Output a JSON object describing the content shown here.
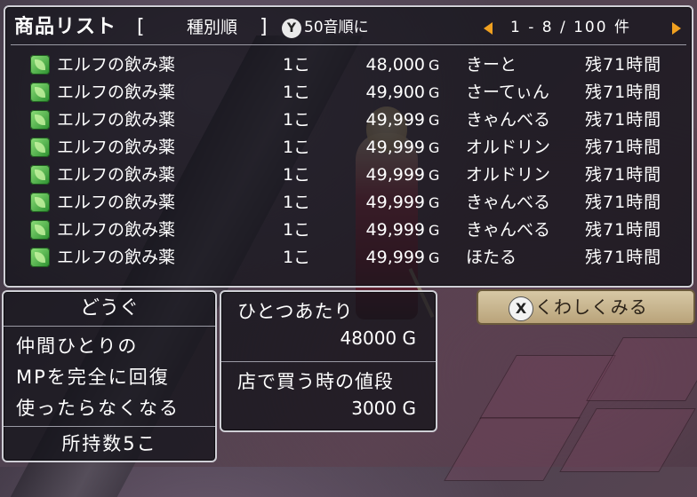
{
  "header": {
    "title": "商品リスト",
    "bracket_open": "[",
    "sort_label": "種別順",
    "bracket_close": "]",
    "y_button": "Y",
    "sort_alt_label": "50音順に",
    "page": "1 - 8 / 100 件"
  },
  "items": [
    {
      "name": "エルフの飲み薬",
      "qty": "1こ",
      "price": "48,000",
      "unit": "G",
      "seller": "きーと",
      "remain": "残71時間"
    },
    {
      "name": "エルフの飲み薬",
      "qty": "1こ",
      "price": "49,900",
      "unit": "G",
      "seller": "さーてぃん",
      "remain": "残71時間"
    },
    {
      "name": "エルフの飲み薬",
      "qty": "1こ",
      "price": "49,999",
      "unit": "G",
      "seller": "きゃんべる",
      "remain": "残71時間"
    },
    {
      "name": "エルフの飲み薬",
      "qty": "1こ",
      "price": "49,999",
      "unit": "G",
      "seller": "オルドリン",
      "remain": "残71時間"
    },
    {
      "name": "エルフの飲み薬",
      "qty": "1こ",
      "price": "49,999",
      "unit": "G",
      "seller": "オルドリン",
      "remain": "残71時間"
    },
    {
      "name": "エルフの飲み薬",
      "qty": "1こ",
      "price": "49,999",
      "unit": "G",
      "seller": "きゃんべる",
      "remain": "残71時間"
    },
    {
      "name": "エルフの飲み薬",
      "qty": "1こ",
      "price": "49,999",
      "unit": "G",
      "seller": "きゃんべる",
      "remain": "残71時間"
    },
    {
      "name": "エルフの飲み薬",
      "qty": "1こ",
      "price": "49,999",
      "unit": "G",
      "seller": "ほたる",
      "remain": "残71時間"
    }
  ],
  "description": {
    "category": "どうぐ",
    "lines": [
      "仲間ひとりの",
      "MPを完全に回復",
      "使ったらなくなる"
    ],
    "owned": "所持数5こ"
  },
  "pricing": {
    "unit_label": "ひとつあたり",
    "unit_price": "48000 G",
    "shop_label": "店で買う時の値段",
    "shop_price": "3000 G"
  },
  "detail_button": {
    "x_button": "X",
    "label": "くわしくみる"
  },
  "colors": {
    "arrow": "#f0a020",
    "leaf_icon": "#4cc24a",
    "panel_border": "#cfcfd6"
  },
  "icons": {
    "item": "elf-potion-leaf-icon",
    "prev": "triangle-left-icon",
    "next": "triangle-right-icon"
  }
}
